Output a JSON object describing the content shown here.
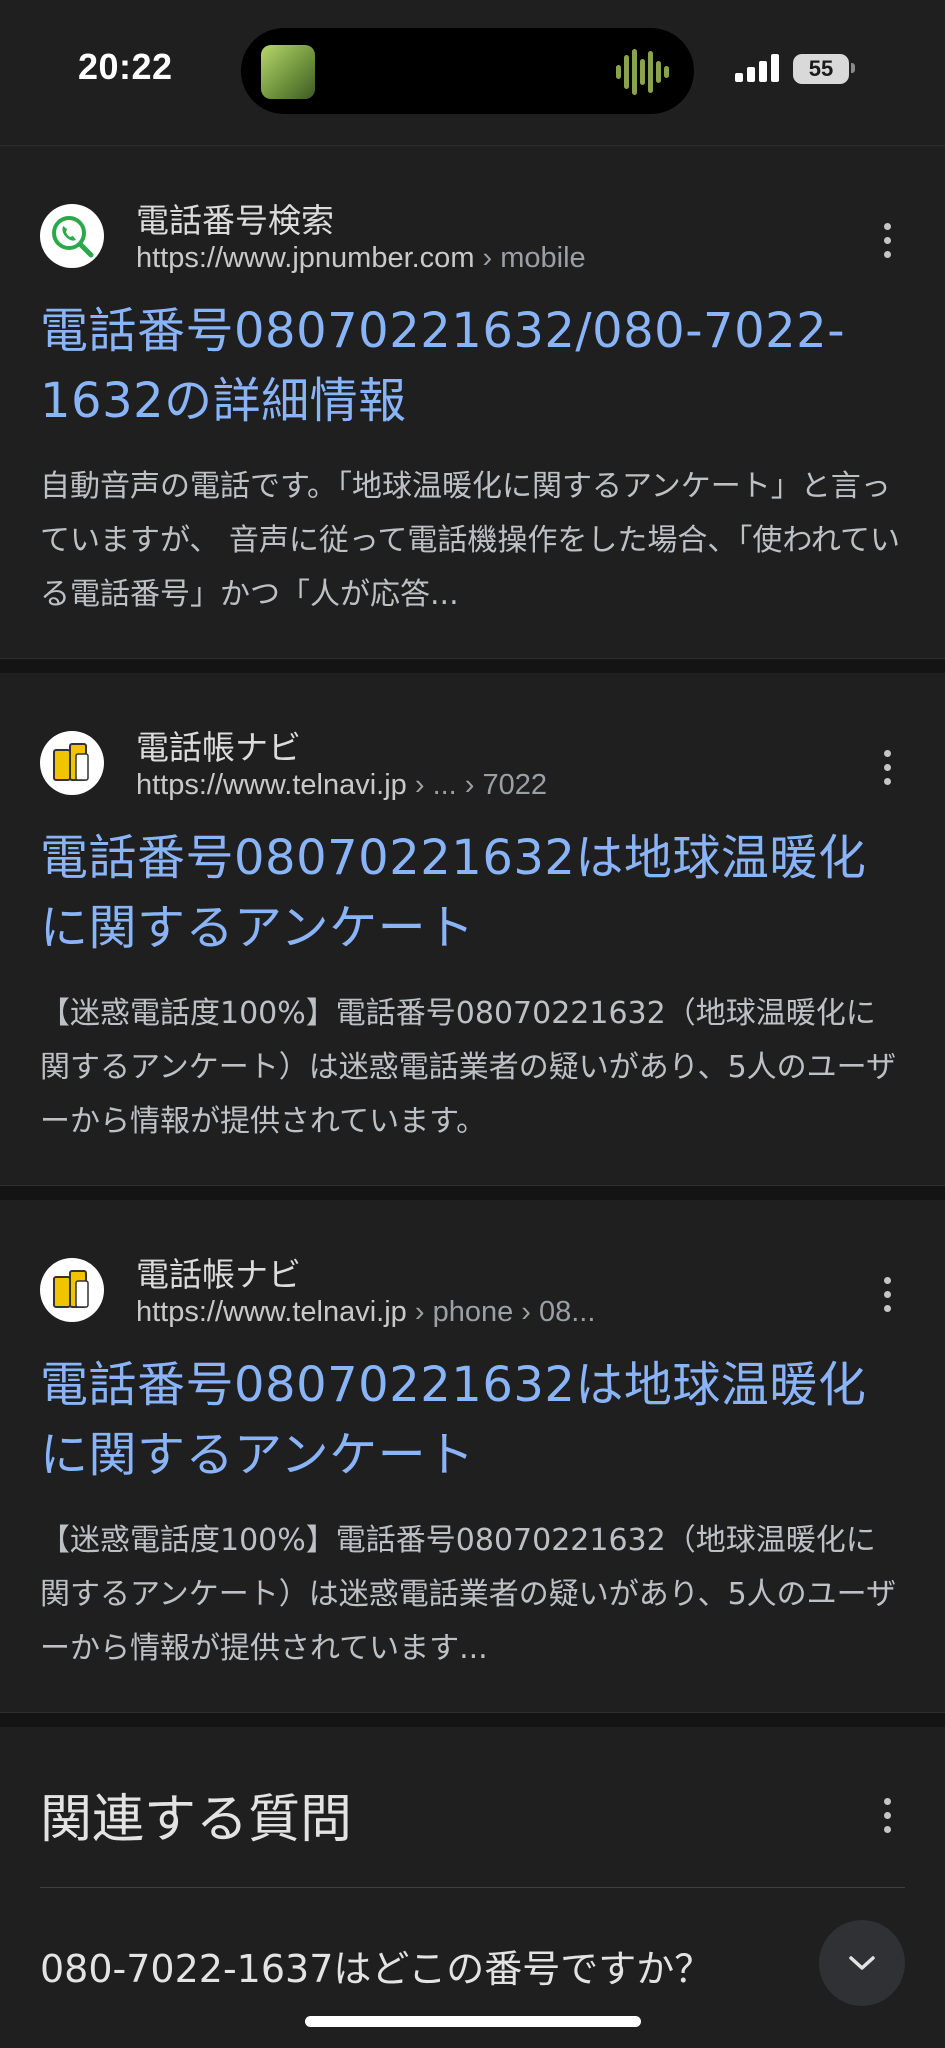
{
  "status_bar": {
    "time": "20:22",
    "battery": "55",
    "icons": [
      "album-art-icon",
      "waveform-icon",
      "signal-icon",
      "battery-icon"
    ]
  },
  "colors": {
    "background": "#1f1f1f",
    "link": "#8ab4f8",
    "snippet": "#bdc1c6"
  },
  "results": [
    {
      "source_name": "電話番号検索",
      "url_host": "https://www.jpnumber.com",
      "url_path": " › mobile",
      "favicon": "phone-search-icon",
      "title": "電話番号08070221632/080-7022-1632の詳細情報",
      "snippet": "自動音声の電話です。「地球温暖化に関するアンケート」と言っていますが、 音声に従って電話機操作をした場合、「使われている電話番号」かつ「人が応答..."
    },
    {
      "source_name": "電話帳ナビ",
      "url_host": "https://www.telnavi.jp",
      "url_path": " › ... › 7022",
      "favicon": "telnavi-icon",
      "title": "電話番号08070221632は地球温暖化に関するアンケート",
      "snippet": "【迷惑電話度100%】電話番号08070221632（地球温暖化に関するアンケート）は迷惑電話業者の疑いがあり、5人のユーザーから情報が提供されています。"
    },
    {
      "source_name": "電話帳ナビ",
      "url_host": "https://www.telnavi.jp",
      "url_path": " › phone › 08...",
      "favicon": "telnavi-icon",
      "title": "電話番号08070221632は地球温暖化に関するアンケート",
      "snippet": "【迷惑電話度100%】電話番号08070221632（地球温暖化に関するアンケート）は迷惑電話業者の疑いがあり、5人のユーザーから情報が提供されています..."
    }
  ],
  "related_questions": {
    "title": "関連する質問",
    "items": [
      {
        "question": "080-7022-1637はどこの番号ですか？"
      }
    ]
  }
}
